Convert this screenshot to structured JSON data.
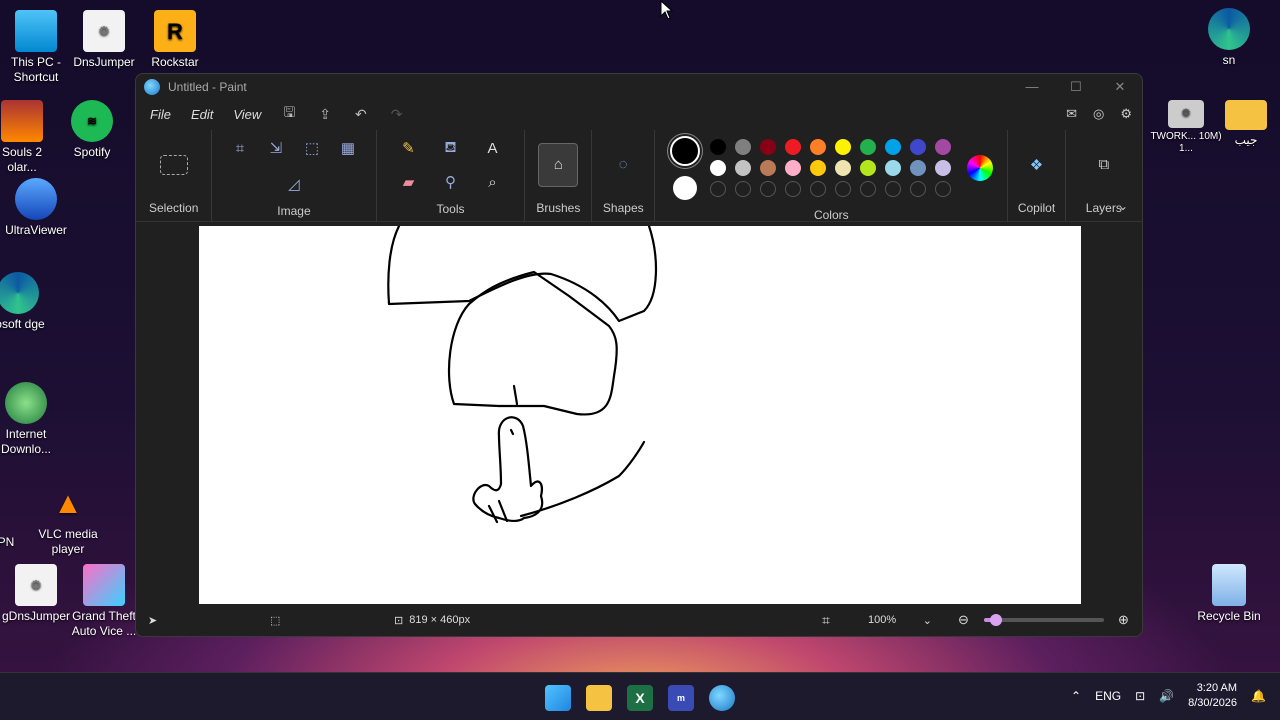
{
  "desktop": {
    "icons": [
      {
        "label": "This PC - Shortcut",
        "icon": "monitor-icon"
      },
      {
        "label": "DnsJumper",
        "icon": "gear-file-icon"
      },
      {
        "label": "Rockstar",
        "icon": "rockstar-icon"
      },
      {
        "label": "Souls 2 olar...",
        "icon": "game-icon"
      },
      {
        "label": "Spotify",
        "icon": "spotify-icon"
      },
      {
        "label": "UltraViewer",
        "icon": "ultraviewer-icon"
      },
      {
        "label": "rosoft dge",
        "icon": "edge-icon"
      },
      {
        "label": "Internet Downlo...",
        "icon": "download-manager-icon"
      },
      {
        "label": "PN",
        "icon": "vpn-icon"
      },
      {
        "label": "VLC media player",
        "icon": "vlc-icon"
      },
      {
        "label": "gDnsJumper",
        "icon": "gear-file-icon"
      },
      {
        "label": "Grand Theft Auto Vice ...",
        "icon": "gta-icon"
      },
      {
        "label": "sn",
        "icon": "edge-icon"
      },
      {
        "label": "TWORK... 10M) 1...",
        "icon": "network-icon"
      },
      {
        "label": "جيب",
        "icon": "folder-icon"
      },
      {
        "label": "Recycle Bin",
        "icon": "recycle-bin-icon"
      }
    ]
  },
  "window": {
    "title": "Untitled - Paint",
    "menu": [
      "File",
      "Edit",
      "View"
    ],
    "groups": {
      "selection": "Selection",
      "image": "Image",
      "tools": "Tools",
      "brushes": "Brushes",
      "shapes": "Shapes",
      "colors": "Colors",
      "copilot": "Copilot",
      "layers": "Layers"
    },
    "colors": {
      "primary": "#000000",
      "secondary": "#ffffff",
      "palette_row1": [
        "#000000",
        "#7f7f7f",
        "#880015",
        "#ed1c24",
        "#ff7f27",
        "#fff200",
        "#22b14c",
        "#00a2e8",
        "#3f48cc",
        "#a349a4"
      ],
      "palette_row2": [
        "#ffffff",
        "#c3c3c3",
        "#b97a57",
        "#ffaec9",
        "#ffc90e",
        "#efe4b0",
        "#b5e61d",
        "#99d9ea",
        "#7092be",
        "#c8bfe7"
      ]
    },
    "status": {
      "canvas_size": "819 × 460px",
      "zoom": "100%",
      "zoom_level": 0.1
    }
  },
  "taskbar": {
    "language": "ENG",
    "time": "3:20 AM",
    "date": "8/30/2026"
  }
}
